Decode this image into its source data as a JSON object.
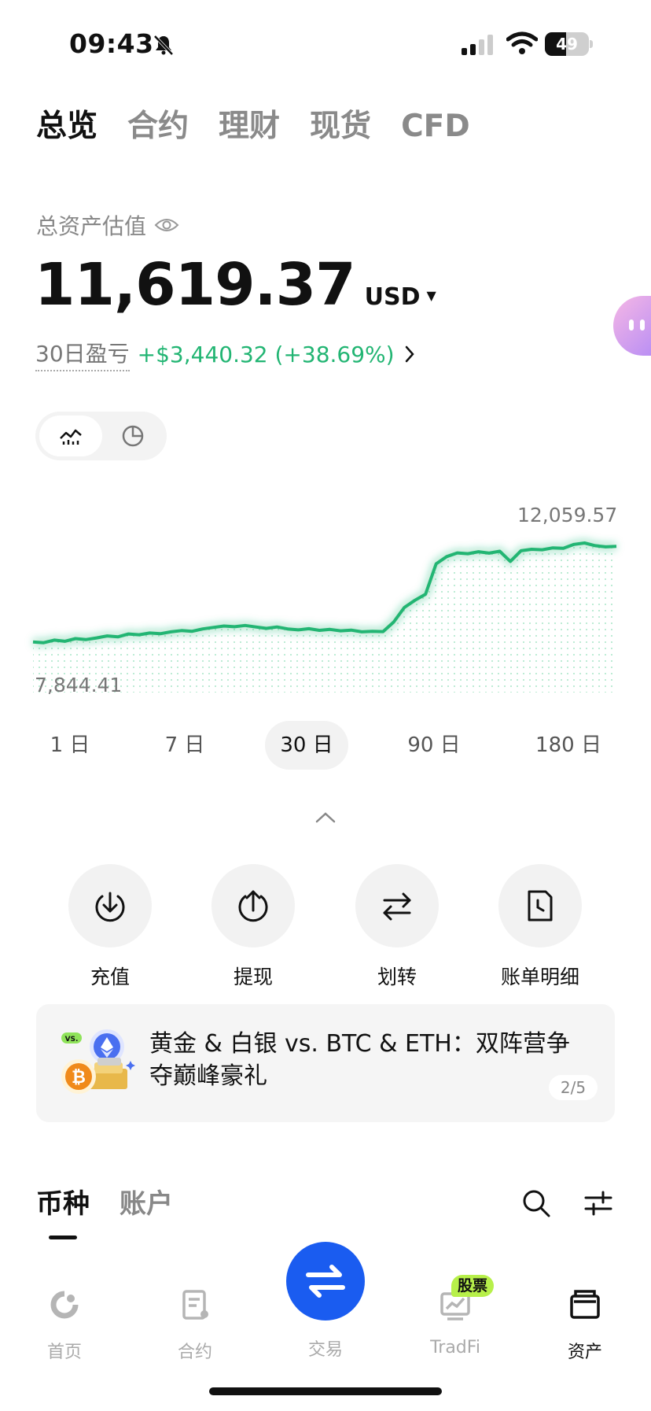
{
  "status_bar": {
    "time": "09:43",
    "battery": "49",
    "battery_level": 0.49
  },
  "top_tabs": [
    {
      "label": "总览",
      "active": true
    },
    {
      "label": "合约",
      "active": false
    },
    {
      "label": "理财",
      "active": false
    },
    {
      "label": "现货",
      "active": false
    },
    {
      "label": "CFD",
      "active": false
    }
  ],
  "assets": {
    "label": "总资产估值",
    "balance": "11,619.37",
    "currency": "USD",
    "pnl_label": "30日盈亏",
    "pnl_value": "+$3,440.32 (+38.69%)"
  },
  "colors": {
    "up": "#22b573",
    "accent": "#1a5cf0",
    "badge": "#b7f04a"
  },
  "chart_data": {
    "type": "line",
    "max_label": "12,059.57",
    "min_label": "7,844.41",
    "ylim": [
      7844.41,
      12059.57
    ],
    "values": [
      7980,
      7950,
      8060,
      8010,
      8120,
      8080,
      8150,
      8230,
      8190,
      8310,
      8280,
      8350,
      8320,
      8400,
      8450,
      8420,
      8520,
      8580,
      8640,
      8610,
      8660,
      8600,
      8540,
      8600,
      8520,
      8480,
      8530,
      8460,
      8500,
      8440,
      8470,
      8400,
      8420,
      8410,
      8800,
      9400,
      9700,
      9950,
      11200,
      11500,
      11650,
      11620,
      11700,
      11640,
      11720,
      11300,
      11740,
      11800,
      11780,
      11860,
      11840,
      12000,
      12059.57,
      11950,
      11900,
      11920
    ]
  },
  "ranges": [
    {
      "label": "1 日",
      "active": false
    },
    {
      "label": "7 日",
      "active": false
    },
    {
      "label": "30 日",
      "active": true
    },
    {
      "label": "90 日",
      "active": false
    },
    {
      "label": "180 日",
      "active": false
    }
  ],
  "actions": [
    {
      "label": "充值",
      "icon": "deposit-icon"
    },
    {
      "label": "提现",
      "icon": "withdraw-icon"
    },
    {
      "label": "划转",
      "icon": "transfer-icon"
    },
    {
      "label": "账单明细",
      "icon": "bill-icon"
    }
  ],
  "banner": {
    "vs_tag": "VS.",
    "text": "黄金 & 白银 vs. BTC & ETH：双阵营争夺巅峰豪礼",
    "page": "2/5"
  },
  "sub_tabs": [
    {
      "label": "币种",
      "active": true
    },
    {
      "label": "账户",
      "active": false
    }
  ],
  "bottom_nav": {
    "home": "首页",
    "contract": "合约",
    "trade": "交易",
    "tradfi": "TradFi",
    "tradfi_badge": "股票",
    "assets": "资产"
  }
}
